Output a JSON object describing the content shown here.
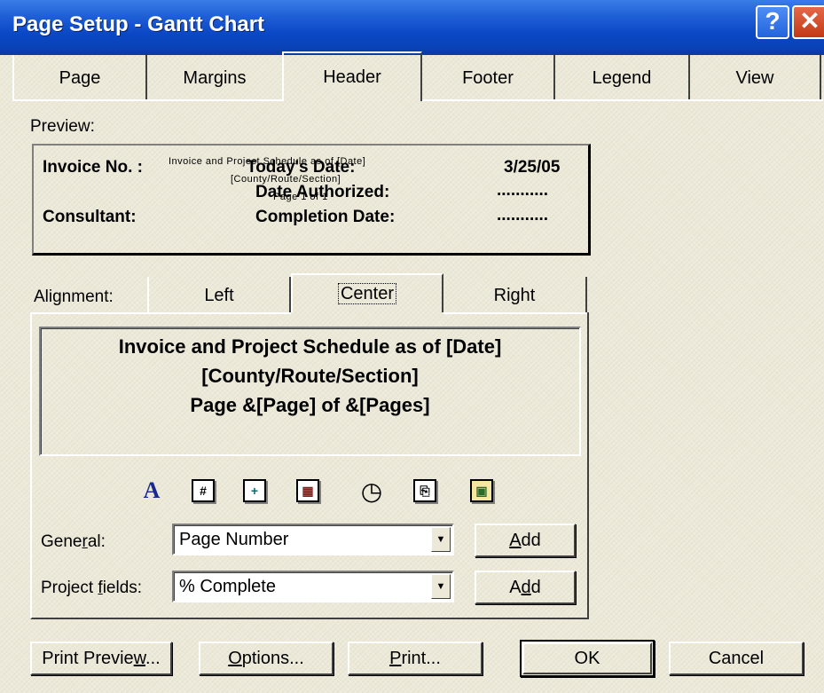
{
  "window": {
    "title": "Page Setup - Gantt Chart",
    "help_glyph": "?",
    "close_glyph": "✕"
  },
  "tabs": [
    {
      "label": "Page"
    },
    {
      "label": "Margins"
    },
    {
      "label": "Header",
      "selected": true
    },
    {
      "label": "Footer"
    },
    {
      "label": "Legend"
    },
    {
      "label": "View"
    }
  ],
  "preview": {
    "label": "Preview:",
    "left_line1": "Invoice No. :",
    "left_line2": "Consultant:",
    "center_small1": "Invoice and Project Schedule as of [Date]",
    "center_small2": "[County/Route/Section]",
    "center_small3": "Page 1 of 1",
    "center_line1": "Today's Date:",
    "center_line2": "Date Authorized:",
    "center_line3": "Completion Date:",
    "right_line1": "3/25/05",
    "right_line2": "...........",
    "right_line3": "..........."
  },
  "alignment": {
    "label": "Alignment:",
    "tabs": [
      {
        "label": "Left"
      },
      {
        "label": "Center",
        "selected": true
      },
      {
        "label": "Right"
      }
    ]
  },
  "editor": {
    "line1": "Invoice and Project Schedule as of  [Date]",
    "line2": "[County/Route/Section]",
    "line3": "Page &[Page] of &[Pages]"
  },
  "toolbar_icons": [
    {
      "name": "format-text-font-icon",
      "glyph": "A"
    },
    {
      "name": "insert-page-number-icon",
      "glyph": "#"
    },
    {
      "name": "insert-total-page-count-icon",
      "glyph": "+"
    },
    {
      "name": "insert-current-date-icon",
      "glyph": "▦"
    },
    {
      "name": "insert-current-time-icon",
      "glyph": "◷"
    },
    {
      "name": "insert-file-name-icon",
      "glyph": "⎘"
    },
    {
      "name": "insert-picture-icon",
      "glyph": "▣"
    }
  ],
  "general": {
    "label_prefix": "Gene",
    "label_mnemonic": "r",
    "label_suffix": "al:",
    "value": "Page Number",
    "add_label_mnemonic": "A",
    "add_label_rest": "dd"
  },
  "project_fields": {
    "label_prefix": "Project ",
    "label_mnemonic": "f",
    "label_suffix": "ields:",
    "value": "% Complete",
    "add_label_pre": "A",
    "add_label_mnemonic": "d",
    "add_label_rest": "d"
  },
  "buttons": {
    "print_preview_pre": "Print Previe",
    "print_preview_mnemonic": "w",
    "print_preview_post": "...",
    "options_mnemonic": "O",
    "options_rest": "ptions...",
    "print_mnemonic": "P",
    "print_rest": "rint...",
    "ok": "OK",
    "cancel": "Cancel"
  }
}
